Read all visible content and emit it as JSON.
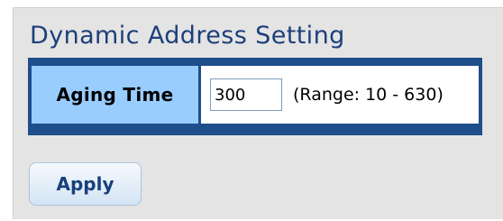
{
  "section": {
    "title": "Dynamic Address Setting"
  },
  "form": {
    "aging_time_label": "Aging Time",
    "aging_time_value": "300",
    "range_hint": "(Range: 10 - 630)"
  },
  "actions": {
    "apply_label": "Apply"
  },
  "colors": {
    "title": "#1d3f7a",
    "table_border": "#1e4e8b",
    "label_background": "#99ccff",
    "panel_background": "#e4e4e4"
  }
}
